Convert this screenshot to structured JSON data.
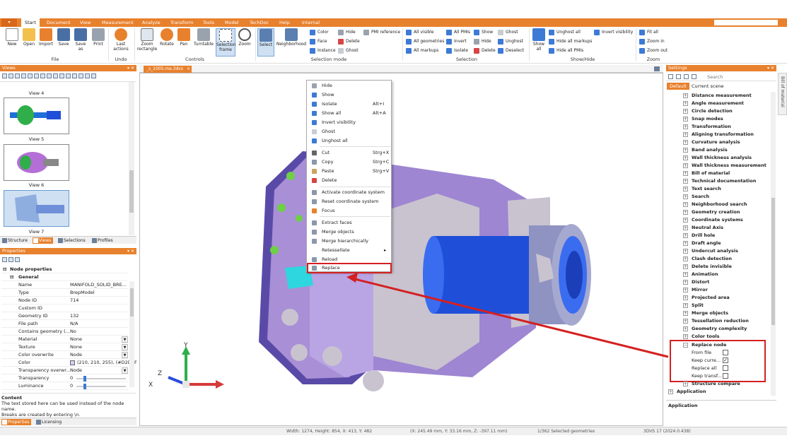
{
  "menubar": {
    "file_label": "▾",
    "tabs": [
      "Start",
      "Document",
      "View",
      "Measurement",
      "Analyze",
      "Transform",
      "Tools",
      "Model",
      "TechDoc",
      "Help",
      "Internal"
    ]
  },
  "ribbon": {
    "file_group": {
      "label": "File",
      "buttons": [
        "New",
        "Open",
        "Import",
        "Save",
        "Save as",
        "Print"
      ]
    },
    "undo_group": {
      "label": "Undo",
      "buttons": [
        "Last actions"
      ]
    },
    "controls_group": {
      "label": "Controls",
      "buttons": [
        "Zoom rectangle",
        "Rotate",
        "Pan",
        "Turntable",
        "Selection frame",
        "Zoom"
      ]
    },
    "selection_mode_group": {
      "label": "Selection mode",
      "buttons": [
        "Select",
        "Neighborhood"
      ],
      "small": [
        "Color",
        "Face",
        "Instance",
        "Hide",
        "Delete",
        "Ghost",
        "PMI reference"
      ]
    },
    "selection_group": {
      "label": "Selection",
      "small": [
        "All visible",
        "All geometries",
        "All markups",
        "All PMIs",
        "Invert",
        "Isolate",
        "Show",
        "Hide",
        "Delete",
        "Ghost",
        "Unghost",
        "Deselect"
      ]
    },
    "showhide_group": {
      "label": "Show/Hide",
      "buttons": [
        "Show all"
      ],
      "small": [
        "Unghost all",
        "Hide all markups",
        "Hide all PMIs",
        "Invert visibility"
      ]
    },
    "zoom_group": {
      "label": "Zoom",
      "small": [
        "Fit all",
        "Zoom in",
        "Zoom out"
      ]
    }
  },
  "views_panel": {
    "title": "Views",
    "views": [
      "View 4",
      "View 5",
      "View 6",
      "View 7"
    ],
    "tabs": [
      "Structure",
      "Views",
      "Selections",
      "Profiles"
    ]
  },
  "properties_panel": {
    "title": "Properties",
    "root": "Node properties",
    "group": "General",
    "rows": [
      {
        "name": "Name",
        "value": "MANIFOLD_SOLID_BRE..."
      },
      {
        "name": "Type",
        "value": "BrepModel"
      },
      {
        "name": "Node ID",
        "value": "714"
      },
      {
        "name": "Custom ID",
        "value": ""
      },
      {
        "name": "Geometry ID",
        "value": "132"
      },
      {
        "name": "File path",
        "value": "N/A"
      },
      {
        "name": "Contains geometry (...",
        "value": "No"
      },
      {
        "name": "Material",
        "value": "None"
      },
      {
        "name": "Texture",
        "value": "None"
      },
      {
        "name": "Color overwrite",
        "value": "Node"
      },
      {
        "name": "Color",
        "value": "(210, 210, 255), (#D2D2F"
      },
      {
        "name": "Transparency overwr...",
        "value": "Node"
      },
      {
        "name": "Transparency",
        "value": "0"
      },
      {
        "name": "Luminance",
        "value": "0"
      }
    ],
    "content_title": "Content",
    "content_text_1": "The text stored here can be used instead of the node name.",
    "content_text_2": "Breaks are created by entering \\n.",
    "tabs": [
      "Properties",
      "Licensing"
    ]
  },
  "document_tab": {
    "label": "_s_1005.me.3dvs",
    "close": "×"
  },
  "context_menu": {
    "items": [
      {
        "label": "Hide",
        "shortcut": ""
      },
      {
        "label": "Show",
        "shortcut": ""
      },
      {
        "label": "Isolate",
        "shortcut": "Alt+I"
      },
      {
        "label": "Show all",
        "shortcut": "Alt+A"
      },
      {
        "label": "Invert visibility",
        "shortcut": ""
      },
      {
        "label": "Ghost",
        "shortcut": ""
      },
      {
        "label": "Unghost all",
        "shortcut": ""
      },
      {
        "label": "Cut",
        "shortcut": "Strg+X"
      },
      {
        "label": "Copy",
        "shortcut": "Strg+C"
      },
      {
        "label": "Paste",
        "shortcut": "Strg+V"
      },
      {
        "label": "Delete",
        "shortcut": ""
      },
      {
        "label": "Activate coordinate system",
        "shortcut": ""
      },
      {
        "label": "Reset coordinate system",
        "shortcut": ""
      },
      {
        "label": "Focus",
        "shortcut": ""
      },
      {
        "label": "Extract faces",
        "shortcut": ""
      },
      {
        "label": "Merge objects",
        "shortcut": ""
      },
      {
        "label": "Merge hierarchically",
        "shortcut": ""
      },
      {
        "label": "Retessellate",
        "shortcut": "▸"
      },
      {
        "label": "Reload",
        "shortcut": ""
      },
      {
        "label": "Replace",
        "shortcut": ""
      }
    ]
  },
  "axes": {
    "x": "X",
    "y": "Y",
    "z": "Z"
  },
  "settings_panel": {
    "title": "Settings",
    "search_placeholder": "Search",
    "tabs": [
      "Default",
      "Current scene"
    ],
    "side_tab": "Bill of material",
    "items": [
      "Distance measurement",
      "Angle measurement",
      "Circle detection",
      "Snap modes",
      "Transformation",
      "Aligning transformation",
      "Curvature analysis",
      "Band analysis",
      "Wall thickness analysis",
      "Wall thickness measurement",
      "Bill of material",
      "Technical documentation",
      "Text search",
      "Search",
      "Neighborhood search",
      "Geometry creation",
      "Coordinate systems",
      "Neutral Axis",
      "Drill hole",
      "Draft angle",
      "Undercut analysis",
      "Clash detection",
      "Delete invisible",
      "Animation",
      "Distort",
      "Mirror",
      "Projected area",
      "Split",
      "Merge objects",
      "Tessellation reduction",
      "Geometry complexity",
      "Color tools"
    ],
    "replace_node": {
      "label": "Replace node",
      "options": [
        {
          "label": "From file",
          "checked": false
        },
        {
          "label": "Keep curre...",
          "checked": true
        },
        {
          "label": "Replace all",
          "checked": false
        },
        {
          "label": "Keep transf...",
          "checked": false
        }
      ]
    },
    "structure_compare": "Structure compare",
    "application_item": "Application",
    "application_footer": "Application"
  },
  "status": {
    "size": "Width: 1274, Height: 854, X: 413, Y: 482",
    "coords": "(X: 245.49 mm, Y: 33.16 mm, Z: -397.11 mm)",
    "selected": "1/362 Selected geometries",
    "version": "3DVS 17 (2024.0.438)"
  },
  "colors": {
    "accent": "#e8812d",
    "highlight": "#d42020",
    "model_purple": "#a88fd6",
    "model_blue": "#1f4fd8"
  }
}
